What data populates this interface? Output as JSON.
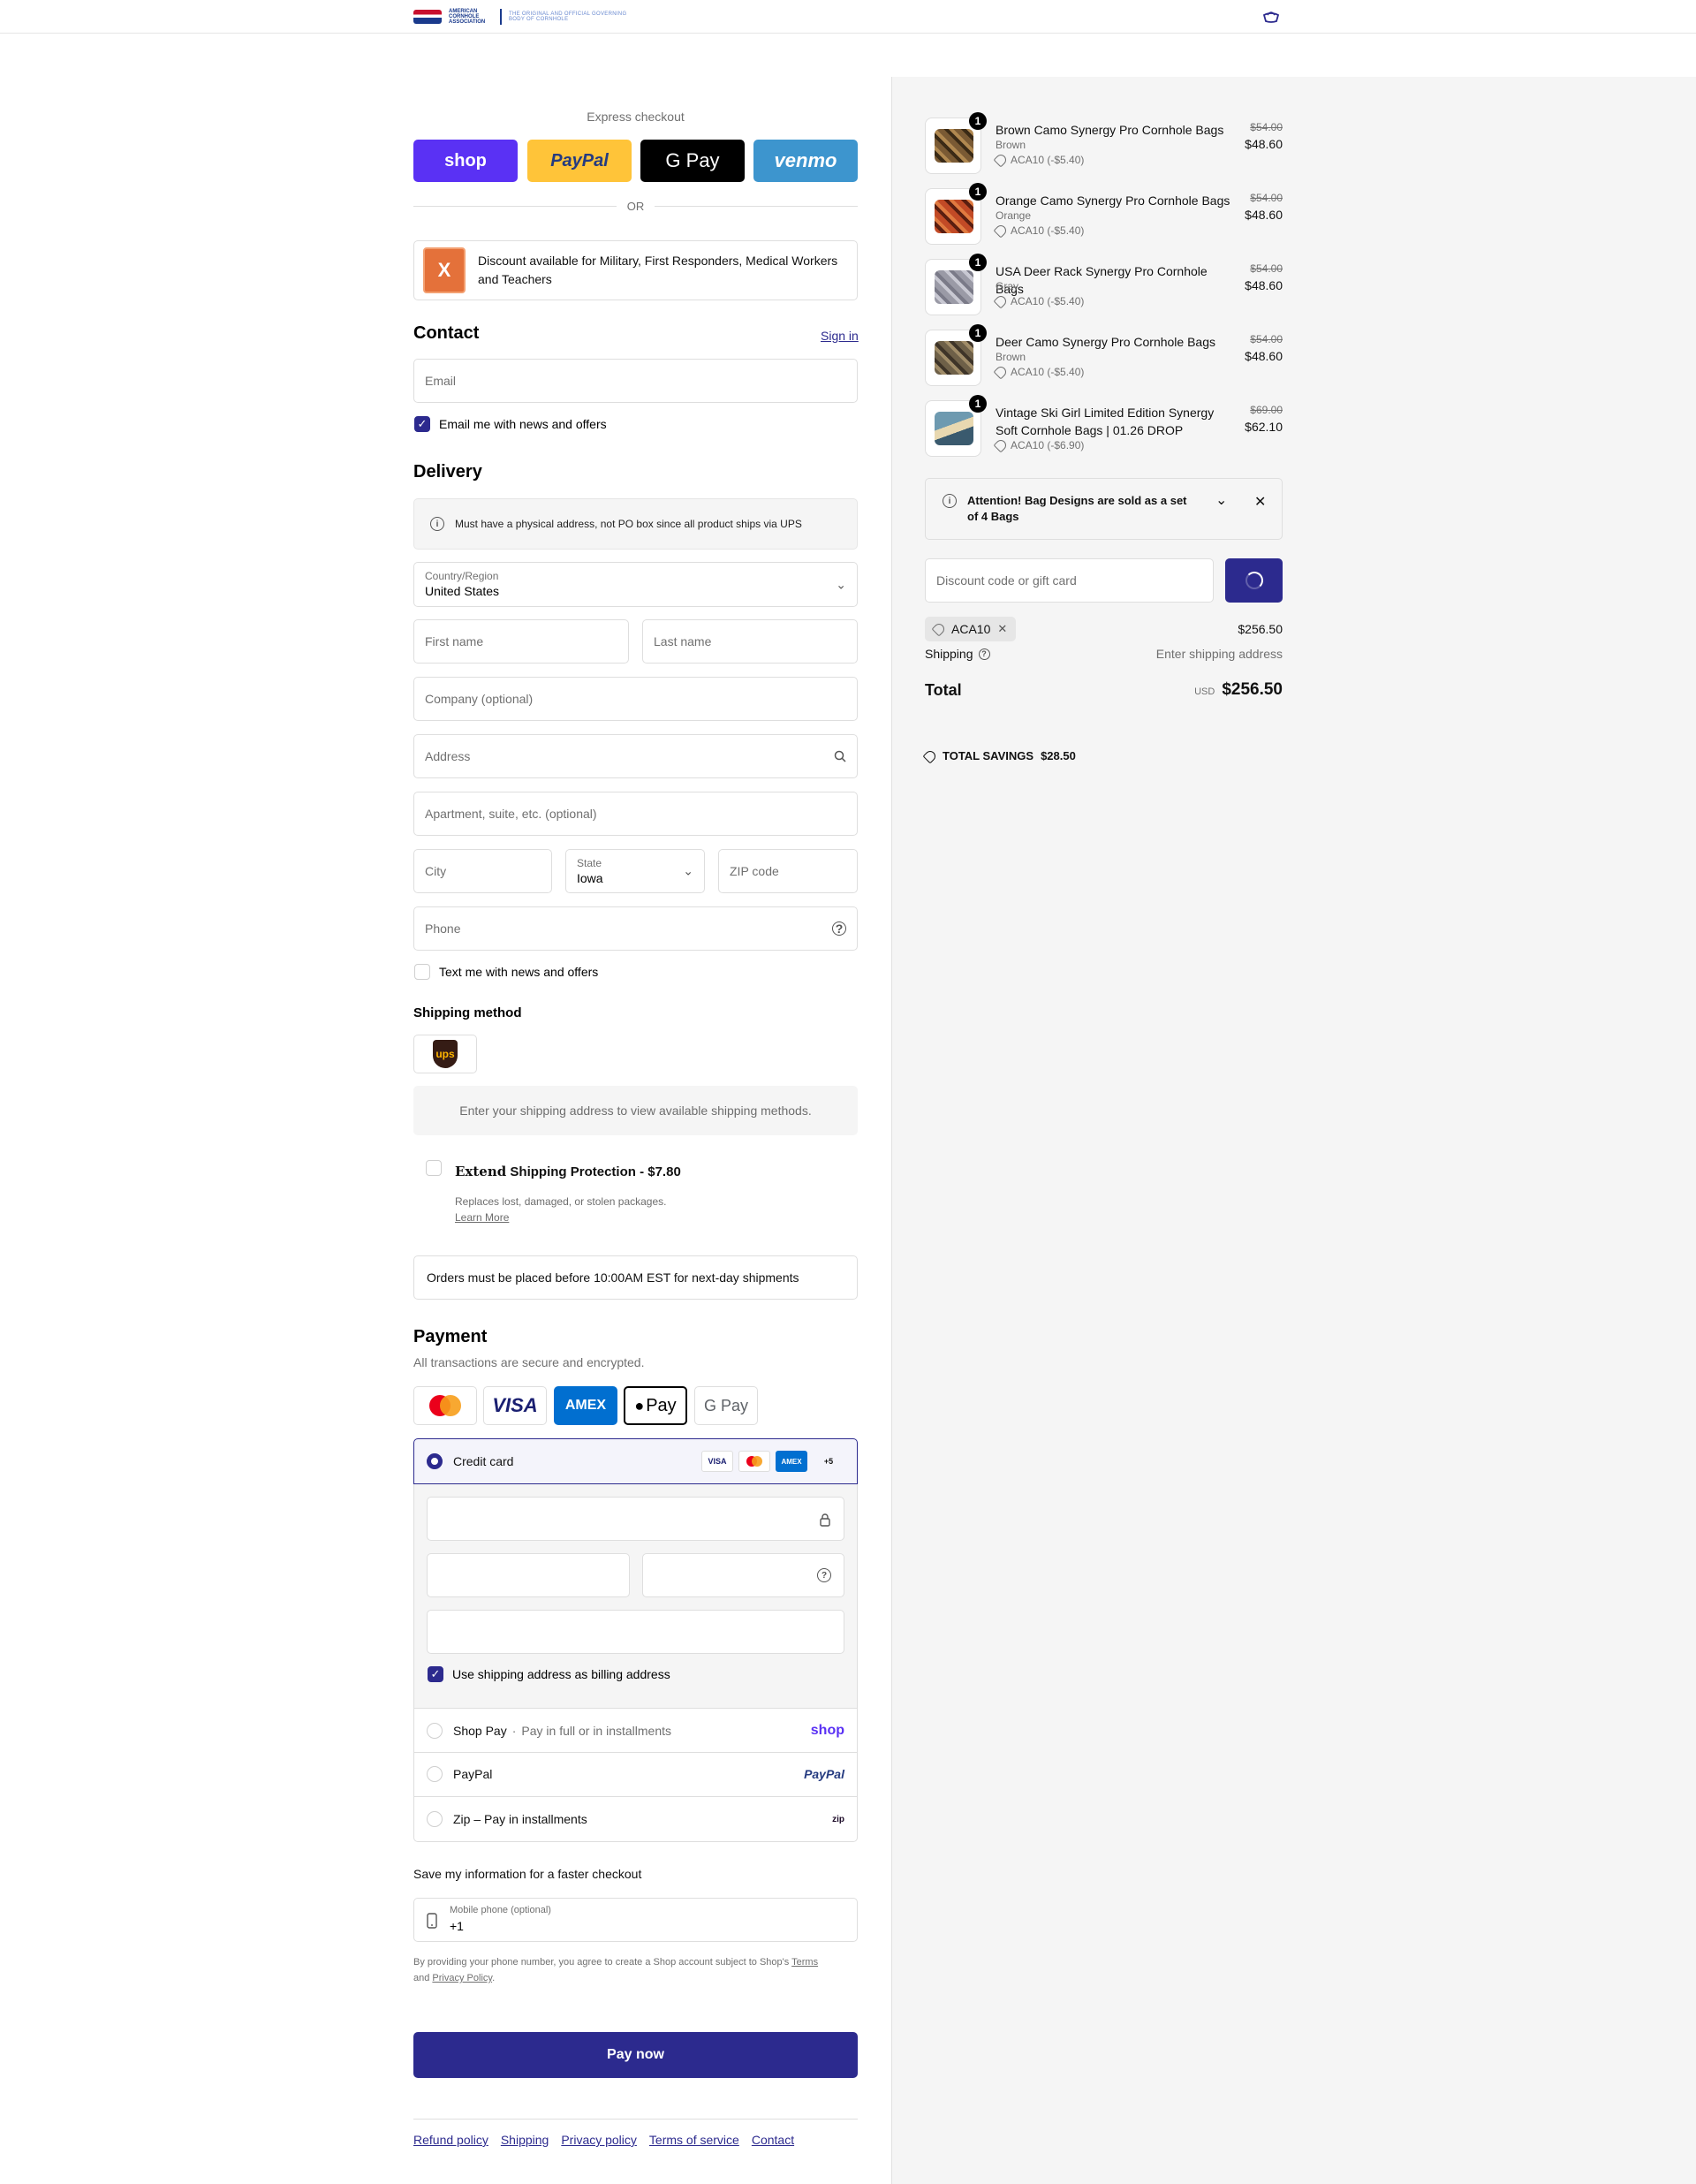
{
  "header": {
    "logo_org": "AMERICAN CORNHOLE ASSOCIATION",
    "logo_tagline": "THE ORIGINAL AND OFFICIAL GOVERNING BODY OF CORNHOLE"
  },
  "express": {
    "label": "Express checkout",
    "buttons": [
      "shop",
      "PayPal",
      "G Pay",
      "venmo"
    ],
    "or": "OR"
  },
  "discount_banner": {
    "logo_text": "X",
    "text": "Discount available for Military, First Responders, Medical Workers and Teachers"
  },
  "contact": {
    "title": "Contact",
    "sign_in": "Sign in",
    "email_placeholder": "Email",
    "news_label": "Email me with news and offers"
  },
  "delivery": {
    "title": "Delivery",
    "notice": "Must have a physical address, not PO box since all product ships via UPS",
    "country_label": "Country/Region",
    "country_value": "United States",
    "first_name": "First name",
    "last_name": "Last name",
    "company": "Company (optional)",
    "address": "Address",
    "apartment": "Apartment, suite, etc. (optional)",
    "city": "City",
    "state_label": "State",
    "state_value": "Iowa",
    "zip": "ZIP code",
    "phone": "Phone",
    "text_label": "Text me with news and offers"
  },
  "shipping": {
    "title": "Shipping method",
    "carrier": "ups",
    "empty_text": "Enter your shipping address to view available shipping methods.",
    "extend_brand": "Extend",
    "extend_title": "Shipping Protection - $7.80",
    "extend_sub": "Replaces lost, damaged, or stolen packages.",
    "extend_learn": "Learn More",
    "deadline": "Orders must be placed before 10:00AM EST for next-day shipments"
  },
  "payment": {
    "title": "Payment",
    "subtitle": "All transactions are secure and encrypted.",
    "logos": [
      "mastercard",
      "VISA",
      "AMEX",
      "Pay",
      "G Pay"
    ],
    "credit_card": "Credit card",
    "card_badges": [
      "VISA",
      "mc",
      "AMEX",
      "+5"
    ],
    "billing_label": "Use shipping address as billing address",
    "shop_pay": "Shop Pay",
    "shop_pay_sub": "Pay in full or in installments",
    "shop_logo": "shop",
    "paypal": "PayPal",
    "paypal_logo": "PayPal",
    "zip": "Zip – Pay in installments",
    "zip_logo": "zip"
  },
  "save_info": {
    "title": "Save my information for a faster checkout",
    "phone_label": "Mobile phone (optional)",
    "phone_value": "+1",
    "terms_prefix": "By providing your phone number, you agree to create a Shop account subject to Shop's",
    "terms_link": "Terms",
    "and": "and",
    "privacy_link": "Privacy Policy",
    "period": "."
  },
  "pay_now": "Pay now",
  "footer": [
    "Refund policy",
    "Shipping",
    "Privacy policy",
    "Terms of service",
    "Contact"
  ],
  "cart": {
    "items": [
      {
        "qty": "1",
        "name": "Brown Camo Synergy Pro Cornhole Bags",
        "variant": "Brown",
        "discount": "ACA10 (-$5.40)",
        "was": "$54.00",
        "price": "$48.60",
        "color": "#7a5a34"
      },
      {
        "qty": "1",
        "name": "Orange Camo Synergy Pro Cornhole Bags",
        "variant": "Orange",
        "discount": "ACA10 (-$5.40)",
        "was": "$54.00",
        "price": "$48.60",
        "color": "#c24a26"
      },
      {
        "qty": "1",
        "name": "USA Deer Rack Synergy Pro Cornhole Bags",
        "variant": "Gray",
        "discount": "ACA10 (-$5.40)",
        "was": "$54.00",
        "price": "$48.60",
        "color": "#9a9aa6"
      },
      {
        "qty": "1",
        "name": "Deer Camo Synergy Pro Cornhole Bags",
        "variant": "Brown",
        "discount": "ACA10 (-$5.40)",
        "was": "$54.00",
        "price": "$48.60",
        "color": "#6e6048"
      },
      {
        "qty": "1",
        "name": "Vintage Ski Girl Limited Edition Synergy Soft Cornhole Bags | 01.26 DROP",
        "variant": "",
        "discount": "ACA10 (-$6.90)",
        "was": "$69.00",
        "price": "$62.10",
        "color": "#6e9ab0"
      }
    ],
    "attention": "Attention! Bag Designs are sold as a set of 4 Bags",
    "discount_placeholder": "Discount code or gift card",
    "applied_code": "ACA10",
    "subtotal_value": "$256.50",
    "shipping_label": "Shipping",
    "shipping_value": "Enter shipping address",
    "total_label": "Total",
    "currency": "USD",
    "total_value": "$256.50",
    "savings_label": "TOTAL SAVINGS",
    "savings_value": "$28.50"
  }
}
